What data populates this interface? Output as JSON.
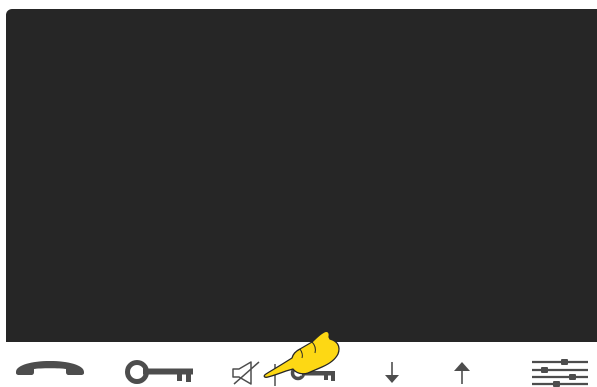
{
  "screen": {
    "state": "video-off",
    "background_color": "#262626"
  },
  "toolbar": {
    "icon_color": "#4d4d4d",
    "buttons": [
      {
        "id": "hang-up",
        "icon": "phone-handset-icon"
      },
      {
        "id": "door-open",
        "icon": "key-icon"
      },
      {
        "id": "mute",
        "icon": "speaker-mute-icon"
      },
      {
        "id": "gate-open",
        "icon": "key-icon"
      },
      {
        "id": "volume-down",
        "icon": "arrow-down-icon"
      },
      {
        "id": "volume-up",
        "icon": "arrow-up-icon"
      },
      {
        "id": "settings",
        "icon": "sliders-icon"
      }
    ]
  },
  "overlay": {
    "pointer": "pointing-hand-icon",
    "pointer_color": "#fdd814",
    "target": "gate-open"
  }
}
